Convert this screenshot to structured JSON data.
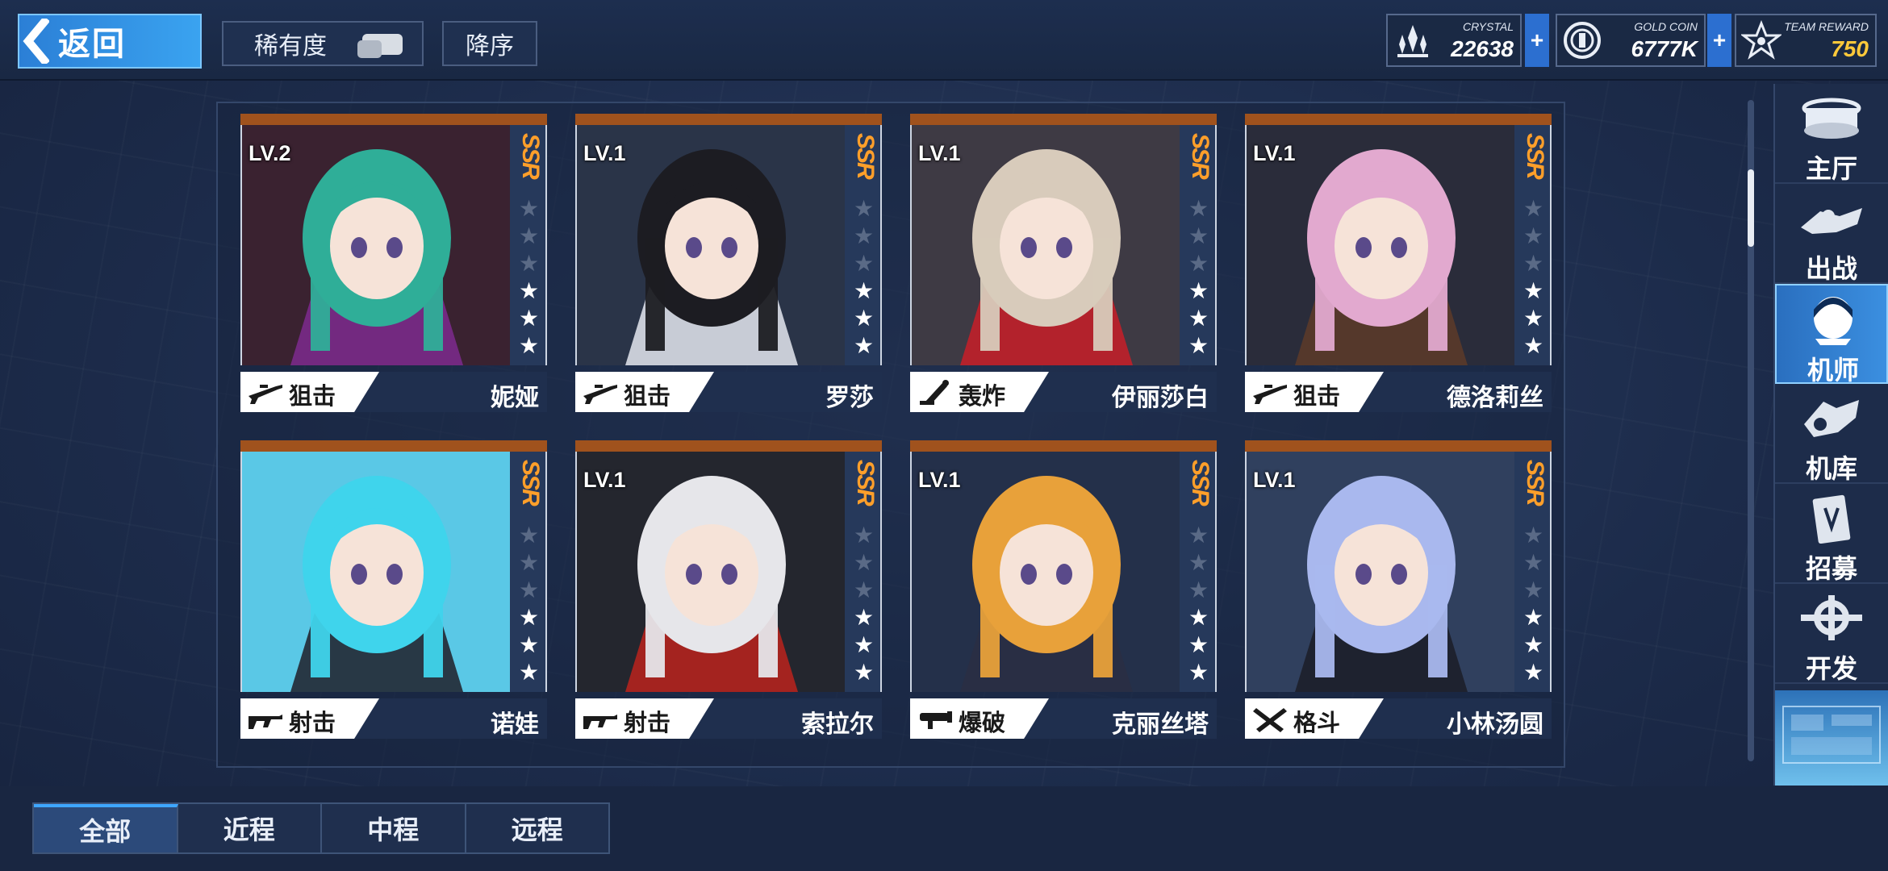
{
  "header": {
    "back_label": "返回",
    "rarity_label": "稀有度",
    "order_label": "降序",
    "resources": [
      {
        "caption": "CRYSTAL",
        "value": "22638",
        "icon": "crystal-icon"
      },
      {
        "caption": "GOLD COIN",
        "value": "6777K",
        "icon": "gold-coin-icon"
      },
      {
        "caption": "TEAM REWARD",
        "value": "750",
        "icon": "star-badge-icon"
      }
    ],
    "plus": "+"
  },
  "cards": [
    {
      "level": "LV.2",
      "rarity": "SSR",
      "role": "狙击",
      "role_icon": "sniper-rifle-icon",
      "name": "妮娅",
      "stars": 3,
      "hair": "#2fae98",
      "bg": "#3a2230",
      "accent": "#7a2a8a"
    },
    {
      "level": "LV.1",
      "rarity": "SSR",
      "role": "狙击",
      "role_icon": "sniper-rifle-icon",
      "name": "罗莎",
      "stars": 3,
      "hair": "#1c1c22",
      "bg": "#2a3448",
      "accent": "#d9dde6"
    },
    {
      "level": "LV.1",
      "rarity": "SSR",
      "role": "轰炸",
      "role_icon": "mortar-icon",
      "name": "伊丽莎白",
      "stars": 3,
      "hair": "#d8cbbb",
      "bg": "#3e3a44",
      "accent": "#c0202a"
    },
    {
      "level": "LV.1",
      "rarity": "SSR",
      "role": "狙击",
      "role_icon": "sniper-rifle-icon",
      "name": "德洛莉丝",
      "stars": 3,
      "hair": "#e2a9cf",
      "bg": "#2a2c3a",
      "accent": "#5a3a2a"
    },
    {
      "level": "",
      "rarity": "SSR",
      "role": "射击",
      "role_icon": "assault-rifle-icon",
      "name": "诺娃",
      "stars": 3,
      "hair": "#3fd4ec",
      "bg": "#5ac8e6",
      "accent": "#222833"
    },
    {
      "level": "LV.1",
      "rarity": "SSR",
      "role": "射击",
      "role_icon": "assault-rifle-icon",
      "name": "索拉尔",
      "stars": 3,
      "hair": "#e6e6ea",
      "bg": "#24262e",
      "accent": "#b3241e"
    },
    {
      "level": "LV.1",
      "rarity": "SSR",
      "role": "爆破",
      "role_icon": "rocket-launcher-icon",
      "name": "克丽丝塔",
      "stars": 3,
      "hair": "#e8a13a",
      "bg": "#24304a",
      "accent": "#2a2f44"
    },
    {
      "level": "LV.1",
      "rarity": "SSR",
      "role": "格斗",
      "role_icon": "crossed-swords-icon",
      "name": "小林汤圆",
      "stars": 3,
      "hair": "#a9b8ee",
      "bg": "#30405e",
      "accent": "#1d1f2a"
    }
  ],
  "sidebar": [
    {
      "label": "主厅",
      "icon": "main-hall-icon",
      "active": false
    },
    {
      "label": "出战",
      "icon": "sortie-icon",
      "active": false
    },
    {
      "label": "机师",
      "icon": "pilot-icon",
      "active": true
    },
    {
      "label": "机库",
      "icon": "hangar-icon",
      "active": false
    },
    {
      "label": "招募",
      "icon": "recruit-icon",
      "active": false
    },
    {
      "label": "开发",
      "icon": "develop-icon",
      "active": false
    }
  ],
  "tabs": [
    {
      "label": "全部",
      "active": true
    },
    {
      "label": "近程",
      "active": false
    },
    {
      "label": "中程",
      "active": false
    },
    {
      "label": "远程",
      "active": false
    }
  ],
  "colors": {
    "accent_blue": "#3aa3f0",
    "ssr_orange": "#ff9f2a",
    "card_top": "#a0521d"
  }
}
